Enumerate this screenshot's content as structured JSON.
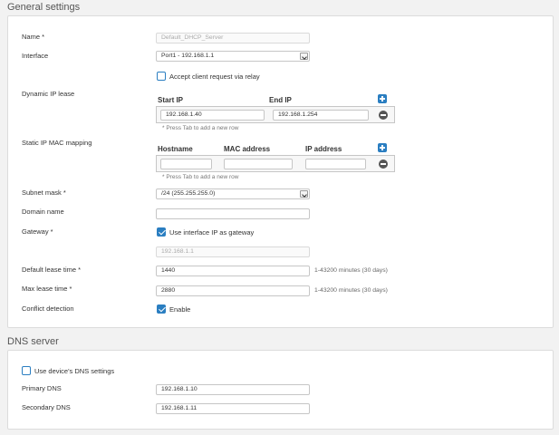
{
  "general": {
    "title": "General settings",
    "name": {
      "label": "Name *",
      "placeholder": "Default_DHCP_Server"
    },
    "interface": {
      "label": "Interface",
      "value": "Port1 - 192.168.1.1"
    },
    "relay": {
      "label": "Accept client request via relay",
      "checked": false
    },
    "dynamic": {
      "label": "Dynamic IP lease",
      "start_header": "Start IP",
      "end_header": "End IP",
      "start_ip": "192.168.1.40",
      "end_ip": "192.168.1.254",
      "hint": "* Press Tab to add a new row"
    },
    "static": {
      "label": "Static IP MAC mapping",
      "hostname_header": "Hostname",
      "mac_header": "MAC address",
      "ip_header": "IP address",
      "hint": "* Press Tab to add a new row"
    },
    "subnet": {
      "label": "Subnet mask *",
      "value": "/24 (255.255.255.0)"
    },
    "domain": {
      "label": "Domain name",
      "value": ""
    },
    "gateway": {
      "label": "Gateway *",
      "use_interface_label": "Use interface IP as gateway",
      "use_interface_checked": true,
      "ip_placeholder": "192.168.1.1"
    },
    "default_lease": {
      "label": "Default lease time *",
      "value": "1440",
      "range": "1-43200 minutes (30 days)"
    },
    "max_lease": {
      "label": "Max lease time *",
      "value": "2880",
      "range": "1-43200 minutes (30 days)"
    },
    "conflict": {
      "label": "Conflict detection",
      "enable_label": "Enable",
      "checked": true
    }
  },
  "dns": {
    "title": "DNS server",
    "use_device": {
      "label": "Use device's DNS settings",
      "checked": false
    },
    "primary": {
      "label": "Primary DNS",
      "value": "192.168.1.10"
    },
    "secondary": {
      "label": "Secondary DNS",
      "value": "192.168.1.11"
    }
  },
  "colors": {
    "accent": "#2a7ec1",
    "remove": "#555555"
  }
}
